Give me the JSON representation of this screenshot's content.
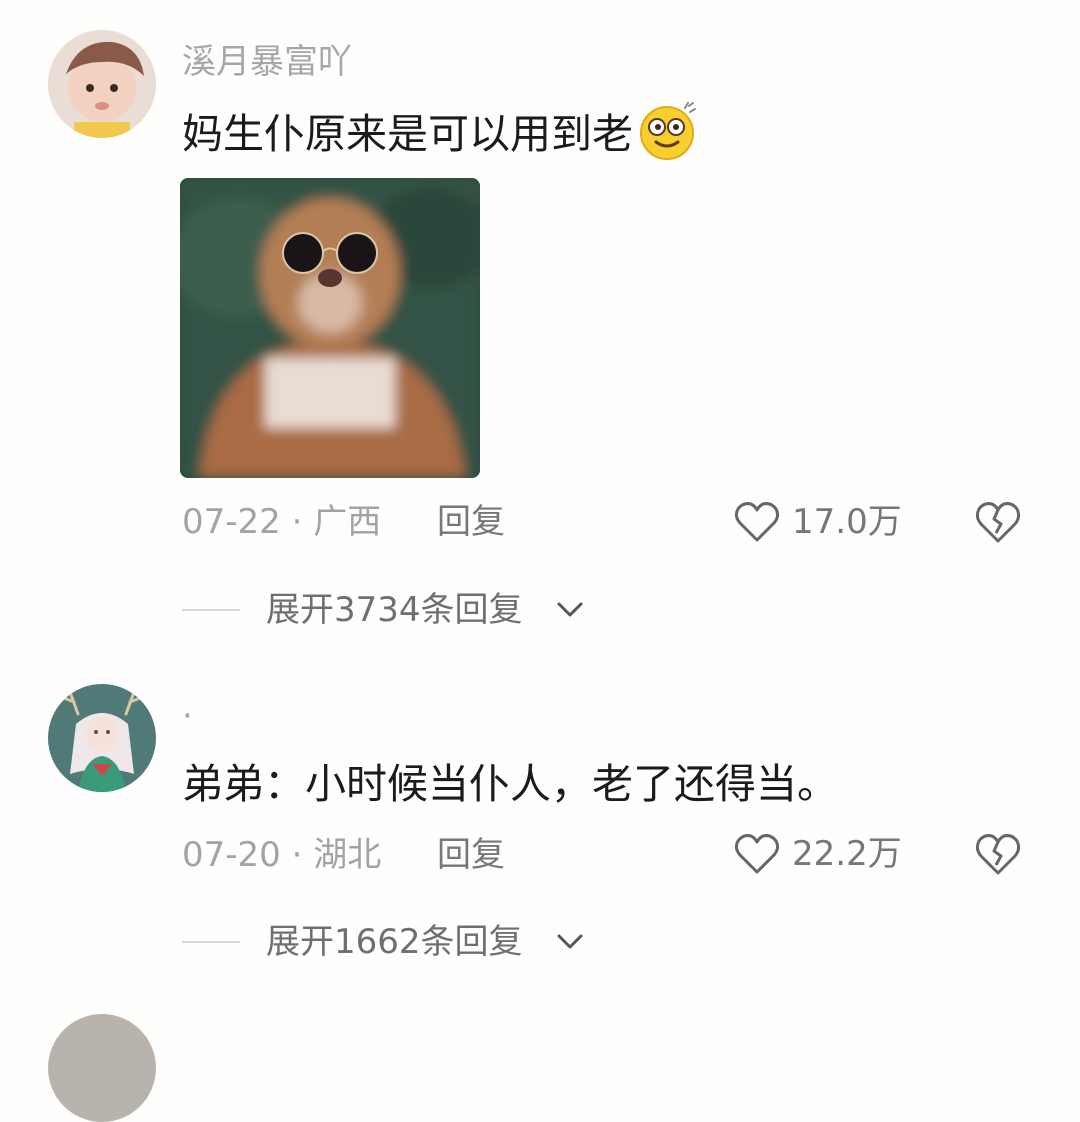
{
  "comments": [
    {
      "username": "溪月暴富吖",
      "text": "妈生仆原来是可以用到老",
      "emoji_icon": "grinning-dizzy-face-emoji",
      "date": "07-22",
      "location": "广西",
      "meta_separator": "·",
      "reply_label": "回复",
      "likes": "17.0万",
      "expand_label": "展开3734条回复"
    },
    {
      "username": "·",
      "text": "弟弟：小时候当仆人，老了还得当。",
      "date": "07-20",
      "location": "湖北",
      "meta_separator": "·",
      "reply_label": "回复",
      "likes": "22.2万",
      "expand_label": "展开1662条回复"
    }
  ],
  "colors": {
    "background": "#fefefc",
    "primary_text": "#1b1b1b",
    "secondary_text": "#a3a3a3",
    "action_text": "#777777"
  }
}
